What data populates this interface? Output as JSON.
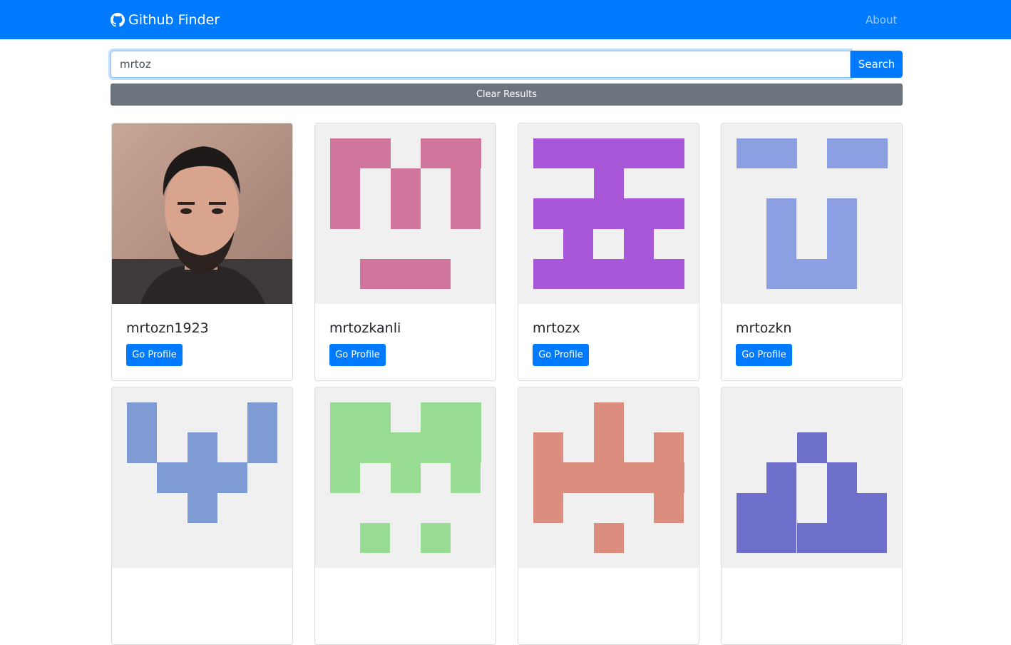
{
  "navbar": {
    "brand": "Github Finder",
    "about": "About"
  },
  "search": {
    "value": "mrtoz",
    "button": "Search",
    "clear": "Clear Results"
  },
  "users": [
    {
      "login": "mrtozn1923",
      "avatar": "photo",
      "button": "Go Profile"
    },
    {
      "login": "mrtozkanli",
      "avatar": "identicon-pink",
      "color": "#d0759c",
      "button": "Go Profile"
    },
    {
      "login": "mrtozx",
      "avatar": "identicon-purple",
      "color": "#a757d8",
      "button": "Go Profile"
    },
    {
      "login": "mrtozkn",
      "avatar": "identicon-periwinkle",
      "color": "#8c9fe3",
      "button": "Go Profile"
    },
    {
      "login": "",
      "avatar": "identicon-blue",
      "color": "#7f9bd4"
    },
    {
      "login": "",
      "avatar": "identicon-green",
      "color": "#98db93"
    },
    {
      "login": "",
      "avatar": "identicon-salmon",
      "color": "#db8e7e"
    },
    {
      "login": "",
      "avatar": "identicon-indigo",
      "color": "#6e6fcb"
    }
  ]
}
